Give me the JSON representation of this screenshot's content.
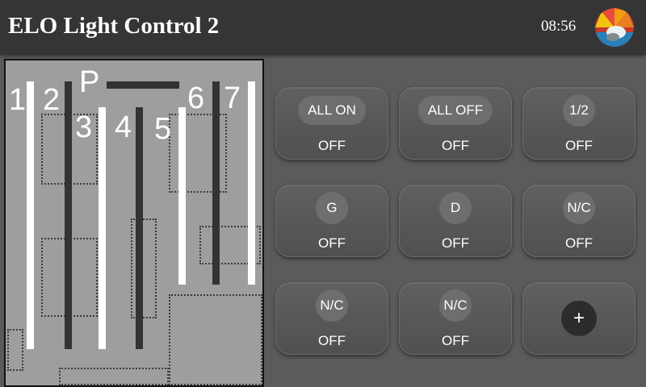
{
  "header": {
    "title": "ELO Light Control 2",
    "time": "08:56",
    "avatar_icon": "user-avatar-icon"
  },
  "floorplan": {
    "labels": [
      "1",
      "2",
      "P",
      "3",
      "4",
      "5",
      "6",
      "7"
    ]
  },
  "tiles": [
    {
      "label": "ALL ON",
      "state": "OFF"
    },
    {
      "label": "ALL OFF",
      "state": "OFF"
    },
    {
      "label": "1/2",
      "state": "OFF"
    },
    {
      "label": "G",
      "state": "OFF"
    },
    {
      "label": "D",
      "state": "OFF"
    },
    {
      "label": "N/C",
      "state": "OFF"
    },
    {
      "label": "N/C",
      "state": "OFF"
    },
    {
      "label": "N/C",
      "state": "OFF"
    }
  ],
  "add_tile": {
    "label": "+"
  }
}
